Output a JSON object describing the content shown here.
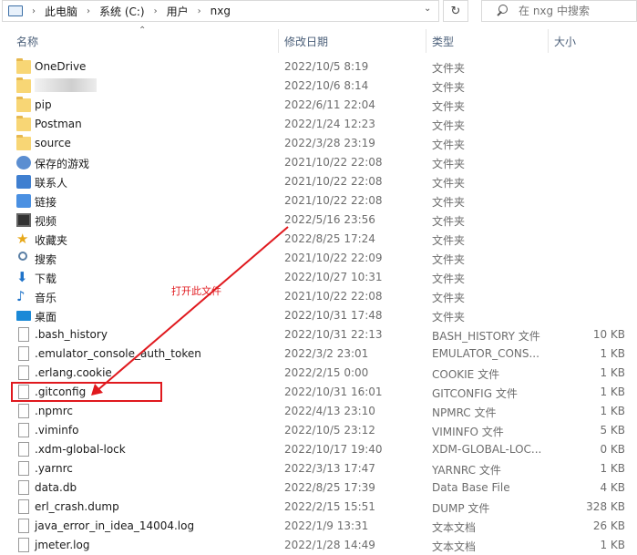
{
  "breadcrumb": [
    "此电脑",
    "系统 (C:)",
    "用户",
    "nxg"
  ],
  "search": {
    "placeholder": "在 nxg 中搜索"
  },
  "columns": {
    "name": "名称",
    "date": "修改日期",
    "type": "类型",
    "size": "大小"
  },
  "rows": [
    {
      "name": "OneDrive",
      "date": "2022/10/5 8:19",
      "type": "文件夹",
      "size": "",
      "icon": "folder-icon"
    },
    {
      "name": "",
      "date": "2022/10/6 8:14",
      "type": "文件夹",
      "size": "",
      "icon": "folder-icon"
    },
    {
      "name": "pip",
      "date": "2022/6/11 22:04",
      "type": "文件夹",
      "size": "",
      "icon": "folder-icon"
    },
    {
      "name": "Postman",
      "date": "2022/1/24 12:23",
      "type": "文件夹",
      "size": "",
      "icon": "folder-icon"
    },
    {
      "name": "source",
      "date": "2022/3/28 23:19",
      "type": "文件夹",
      "size": "",
      "icon": "folder-icon"
    },
    {
      "name": "保存的游戏",
      "date": "2021/10/22 22:08",
      "type": "文件夹",
      "size": "",
      "icon": "saved-games-icon"
    },
    {
      "name": "联系人",
      "date": "2021/10/22 22:08",
      "type": "文件夹",
      "size": "",
      "icon": "contacts-icon"
    },
    {
      "name": "链接",
      "date": "2021/10/22 22:08",
      "type": "文件夹",
      "size": "",
      "icon": "links-icon"
    },
    {
      "name": "视频",
      "date": "2022/5/16 23:56",
      "type": "文件夹",
      "size": "",
      "icon": "videos-icon"
    },
    {
      "name": "收藏夹",
      "date": "2022/8/25 17:24",
      "type": "文件夹",
      "size": "",
      "icon": "favorites-icon"
    },
    {
      "name": "搜索",
      "date": "2021/10/22 22:09",
      "type": "文件夹",
      "size": "",
      "icon": "searches-icon"
    },
    {
      "name": "下载",
      "date": "2022/10/27 10:31",
      "type": "文件夹",
      "size": "",
      "icon": "downloads-icon"
    },
    {
      "name": "音乐",
      "date": "2021/10/22 22:08",
      "type": "文件夹",
      "size": "",
      "icon": "music-icon"
    },
    {
      "name": "桌面",
      "date": "2022/10/31 17:48",
      "type": "文件夹",
      "size": "",
      "icon": "desktop-icon"
    },
    {
      "name": ".bash_history",
      "date": "2022/10/31 22:13",
      "type": "BASH_HISTORY 文件",
      "size": "10 KB",
      "icon": "file-icon"
    },
    {
      "name": ".emulator_console_auth_token",
      "date": "2022/3/2 23:01",
      "type": "EMULATOR_CONS...",
      "size": "1 KB",
      "icon": "file-icon"
    },
    {
      "name": ".erlang.cookie",
      "date": "2022/2/15 0:00",
      "type": "COOKIE 文件",
      "size": "1 KB",
      "icon": "file-icon"
    },
    {
      "name": ".gitconfig",
      "date": "2022/10/31 16:01",
      "type": "GITCONFIG 文件",
      "size": "1 KB",
      "icon": "file-icon"
    },
    {
      "name": ".npmrc",
      "date": "2022/4/13 23:10",
      "type": "NPMRC 文件",
      "size": "1 KB",
      "icon": "file-icon"
    },
    {
      "name": ".viminfo",
      "date": "2022/10/5 23:12",
      "type": "VIMINFO 文件",
      "size": "5 KB",
      "icon": "file-icon"
    },
    {
      "name": ".xdm-global-lock",
      "date": "2022/10/17 19:40",
      "type": "XDM-GLOBAL-LOC...",
      "size": "0 KB",
      "icon": "file-icon"
    },
    {
      "name": ".yarnrc",
      "date": "2022/3/13 17:47",
      "type": "YARNRC 文件",
      "size": "1 KB",
      "icon": "file-icon"
    },
    {
      "name": "data.db",
      "date": "2022/8/25 17:39",
      "type": "Data Base File",
      "size": "4 KB",
      "icon": "file-icon"
    },
    {
      "name": "erl_crash.dump",
      "date": "2022/2/15 15:51",
      "type": "DUMP 文件",
      "size": "328 KB",
      "icon": "file-icon"
    },
    {
      "name": "java_error_in_idea_14004.log",
      "date": "2022/1/9 13:31",
      "type": "文本文档",
      "size": "26 KB",
      "icon": "file-icon"
    },
    {
      "name": "jmeter.log",
      "date": "2022/1/28 14:49",
      "type": "文本文档",
      "size": "1 KB",
      "icon": "file-icon"
    }
  ],
  "annotation": {
    "text": "打开此文件",
    "color": "#e0191e",
    "target": ".gitconfig"
  }
}
